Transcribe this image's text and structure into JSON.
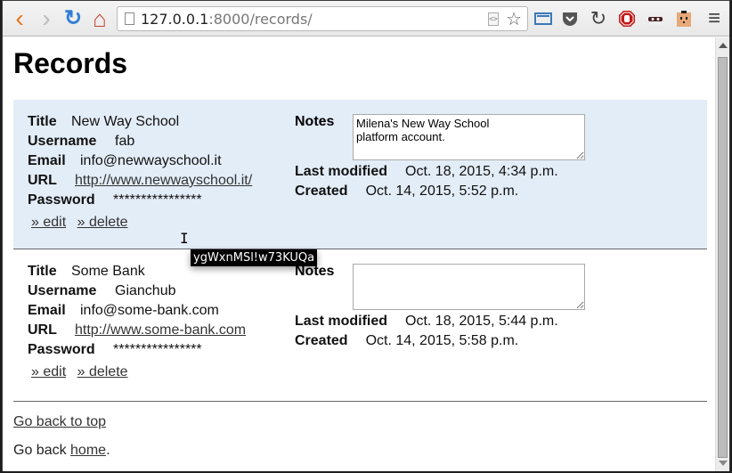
{
  "browser": {
    "url_host": "127.0.0.1",
    "url_rest": ":8000/records/",
    "nav": {
      "back_icon": "‹",
      "forward_icon": "›",
      "reload_icon": "↻",
      "home_icon": "⌂"
    },
    "star_icon": "☆",
    "extensions": [
      "cast-icon",
      "pocket-icon",
      "refresh-extension-icon",
      "adblock-stop-icon",
      "incognito-mask-icon",
      "face-extension-icon"
    ],
    "menu_icon": "≡"
  },
  "page": {
    "title": "Records",
    "records": [
      {
        "title_label": "Title",
        "title": "New Way School",
        "username_label": "Username",
        "username": "fab",
        "email_label": "Email",
        "email": "info@newwayschool.it",
        "url_label": "URL",
        "url": "http://www.newwayschool.it/",
        "password_label": "Password",
        "password_masked": "****************",
        "edit_label": "» edit",
        "delete_label": "» delete",
        "notes_label": "Notes",
        "notes": "Milena's New Way School\nplatform account.",
        "last_modified_label": "Last modified",
        "last_modified": "Oct. 18, 2015, 4:34 p.m.",
        "created_label": "Created",
        "created": "Oct. 14, 2015, 5:52 p.m."
      },
      {
        "title_label": "Title",
        "title": "Some Bank",
        "username_label": "Username",
        "username": "Gianchub",
        "email_label": "Email",
        "email": "info@some-bank.com",
        "url_label": "URL",
        "url": "http://www.some-bank.com",
        "password_label": "Password",
        "password_masked": "****************",
        "edit_label": "» edit",
        "delete_label": "» delete",
        "notes_label": "Notes",
        "notes": "",
        "last_modified_label": "Last modified",
        "last_modified": "Oct. 18, 2015, 5:44 p.m.",
        "created_label": "Created",
        "created": "Oct. 14, 2015, 5:58 p.m."
      }
    ],
    "tooltip": "ygWxnMSl!w73KUQa",
    "footer": {
      "back_to_top": "Go back to top",
      "go_back_prefix": "Go back ",
      "home_link": "home",
      "go_back_suffix": "."
    }
  },
  "colors": {
    "highlight_record_bg": "#e3edf8",
    "tooltip_bg": "#000000",
    "tooltip_fg": "#ffffff"
  }
}
